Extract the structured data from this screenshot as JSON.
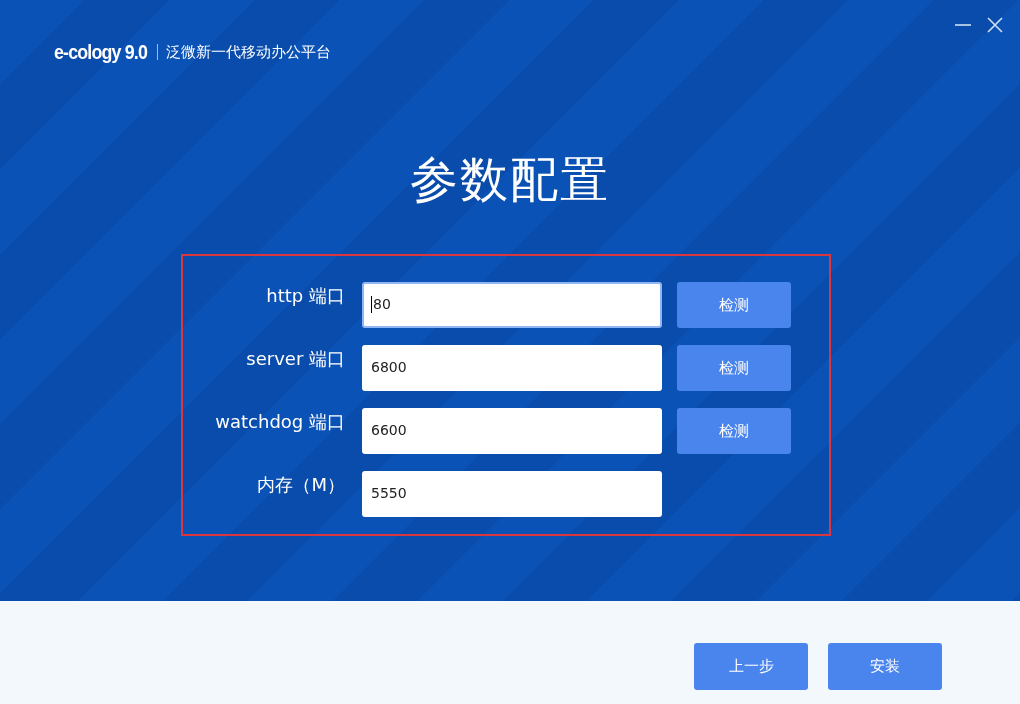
{
  "header": {
    "logo": "e-cology 9.0",
    "subtitle": "泛微新一代移动办公平台"
  },
  "title": "参数配置",
  "fields": [
    {
      "label": "http 端口",
      "value": "80",
      "focused": true,
      "check_button": "检测"
    },
    {
      "label": "server 端口",
      "value": "6800",
      "focused": false,
      "check_button": "检测"
    },
    {
      "label": "watchdog 端口",
      "value": "6600",
      "focused": false,
      "check_button": "检测"
    },
    {
      "label": "内存（M）",
      "value": "5550",
      "focused": false
    }
  ],
  "buttons": [
    "上一步",
    "安装"
  ]
}
